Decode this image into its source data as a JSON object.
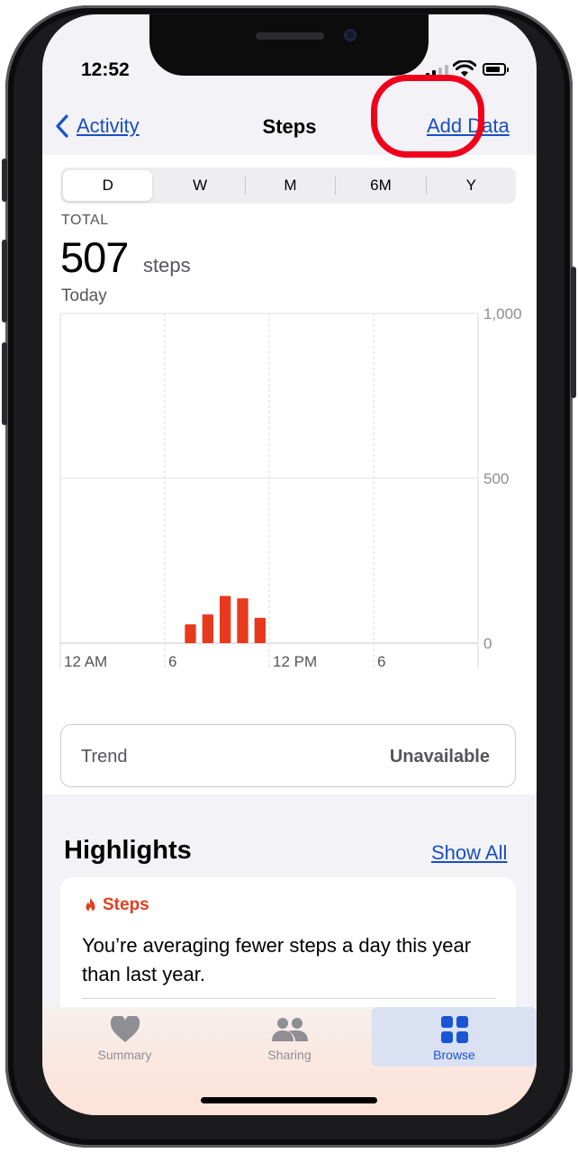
{
  "status_bar": {
    "time": "12:52"
  },
  "nav": {
    "back_label": "Activity",
    "title": "Steps",
    "action_label": "Add Data"
  },
  "segments": [
    "D",
    "W",
    "M",
    "6M",
    "Y"
  ],
  "summary": {
    "total_label": "TOTAL",
    "value": "507",
    "unit": "steps",
    "period": "Today"
  },
  "chart_data": {
    "type": "bar",
    "x_tick_labels": [
      "12 AM",
      "6",
      "12 PM",
      "6"
    ],
    "y_tick_labels": [
      "1,000",
      "500",
      "0"
    ],
    "ylim": [
      0,
      1000
    ],
    "bar_color": "#e8391c",
    "bars": [
      {
        "hour": 7,
        "value": 57
      },
      {
        "hour": 8,
        "value": 87
      },
      {
        "hour": 9,
        "value": 143
      },
      {
        "hour": 10,
        "value": 136
      },
      {
        "hour": 11,
        "value": 77
      }
    ]
  },
  "trend": {
    "label": "Trend",
    "value": "Unavailable"
  },
  "highlights": {
    "title": "Highlights",
    "show_all": "Show All",
    "card": {
      "category": "Steps",
      "text": "You’re averaging fewer steps a day this year than last year."
    }
  },
  "tabs": [
    {
      "label": "Summary",
      "icon": "heart-icon"
    },
    {
      "label": "Sharing",
      "icon": "people-icon"
    },
    {
      "label": "Browse",
      "icon": "grid-icon"
    }
  ],
  "colors": {
    "accent": "#1a4fbf",
    "highlight_ring": "#f0001b",
    "steps_orange": "#e0401f"
  }
}
